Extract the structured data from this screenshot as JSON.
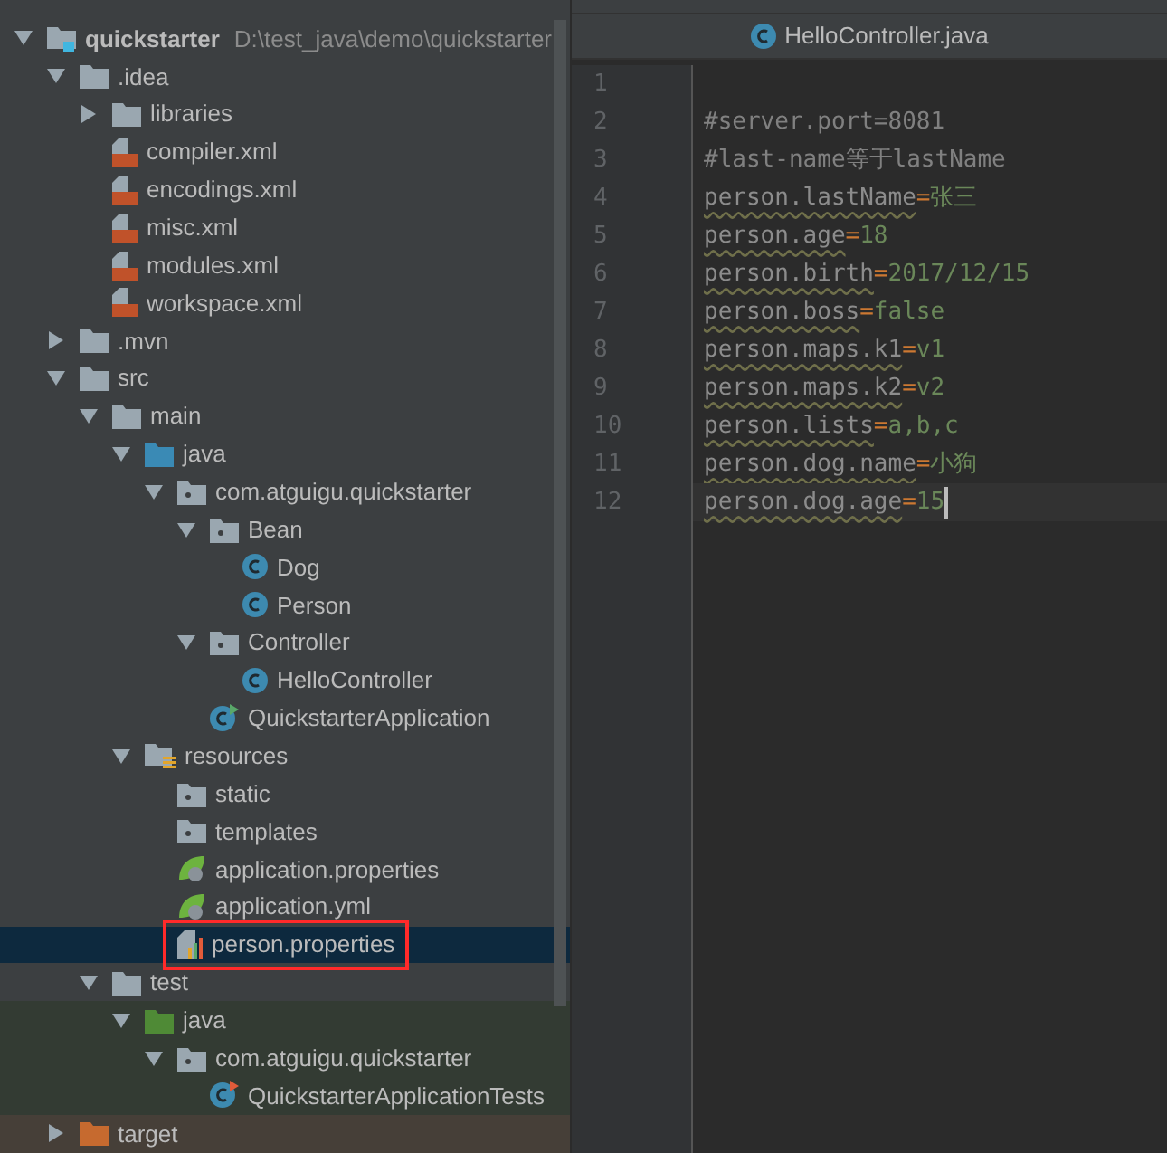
{
  "project_tree": {
    "items": [
      {
        "label": "quickstarter",
        "path": "D:\\test_java\\demo\\quickstarter",
        "kind": "module",
        "expanded": true,
        "selected": false,
        "children": [
          {
            "label": ".idea",
            "kind": "folder",
            "expanded": true,
            "selected": false,
            "children": [
              {
                "label": "libraries",
                "kind": "folder",
                "expanded": false,
                "selected": false
              },
              {
                "label": "compiler.xml",
                "kind": "xml",
                "selected": false
              },
              {
                "label": "encodings.xml",
                "kind": "xml",
                "selected": false
              },
              {
                "label": "misc.xml",
                "kind": "xml",
                "selected": false
              },
              {
                "label": "modules.xml",
                "kind": "xml",
                "selected": false
              },
              {
                "label": "workspace.xml",
                "kind": "xml",
                "selected": false
              }
            ]
          },
          {
            "label": ".mvn",
            "kind": "folder",
            "expanded": false,
            "selected": false
          },
          {
            "label": "src",
            "kind": "folder",
            "expanded": true,
            "selected": false,
            "children": [
              {
                "label": "main",
                "kind": "folder",
                "expanded": true,
                "selected": false,
                "children": [
                  {
                    "label": "java",
                    "kind": "source",
                    "expanded": true,
                    "selected": false,
                    "children": [
                      {
                        "label": "com.atguigu.quickstarter",
                        "kind": "package",
                        "expanded": true,
                        "selected": false,
                        "children": [
                          {
                            "label": "Bean",
                            "kind": "package",
                            "expanded": true,
                            "selected": false,
                            "children": [
                              {
                                "label": "Dog",
                                "kind": "class",
                                "selected": false
                              },
                              {
                                "label": "Person",
                                "kind": "class",
                                "selected": false
                              }
                            ]
                          },
                          {
                            "label": "Controller",
                            "kind": "package",
                            "expanded": true,
                            "selected": false,
                            "children": [
                              {
                                "label": "HelloController",
                                "kind": "class",
                                "selected": false
                              }
                            ]
                          },
                          {
                            "label": "QuickstarterApplication",
                            "kind": "boot",
                            "selected": false
                          }
                        ]
                      }
                    ]
                  },
                  {
                    "label": "resources",
                    "kind": "resources",
                    "expanded": true,
                    "selected": false,
                    "children": [
                      {
                        "label": "static",
                        "kind": "package",
                        "selected": false
                      },
                      {
                        "label": "templates",
                        "kind": "package",
                        "selected": false
                      },
                      {
                        "label": "application.properties",
                        "kind": "spring",
                        "selected": false
                      },
                      {
                        "label": "application.yml",
                        "kind": "spring",
                        "selected": false
                      },
                      {
                        "label": "person.properties",
                        "kind": "properties",
                        "selected": true,
                        "annotated": true
                      }
                    ]
                  }
                ]
              },
              {
                "label": "test",
                "kind": "folder",
                "expanded": true,
                "selected": false,
                "children": [
                  {
                    "label": "java",
                    "kind": "test",
                    "expanded": true,
                    "selected": false,
                    "children": [
                      {
                        "label": "com.atguigu.quickstarter",
                        "kind": "package",
                        "expanded": true,
                        "selected": false,
                        "children": [
                          {
                            "label": "QuickstarterApplicationTests",
                            "kind": "testclass",
                            "selected": false
                          }
                        ]
                      }
                    ]
                  }
                ]
              }
            ]
          },
          {
            "label": "target",
            "kind": "excluded",
            "expanded": false,
            "selected": false
          }
        ]
      }
    ]
  },
  "editor": {
    "file_tab": {
      "label": "HelloController.java"
    },
    "lines": [
      {
        "number": "1",
        "kind": "blank",
        "current": false
      },
      {
        "number": "2",
        "kind": "comment",
        "text": "#server.port=8081",
        "current": false
      },
      {
        "number": "3",
        "kind": "comment",
        "text": "#last-name等于lastName",
        "current": false
      },
      {
        "number": "4",
        "kind": "property",
        "key": "person.lastName",
        "sep": "=",
        "value": "张三",
        "current": false
      },
      {
        "number": "5",
        "kind": "property",
        "key": "person.age",
        "sep": "=",
        "value": "18",
        "current": false
      },
      {
        "number": "6",
        "kind": "property",
        "key": "person.birth",
        "sep": "=",
        "value": "2017/12/15",
        "current": false
      },
      {
        "number": "7",
        "kind": "property",
        "key": "person.boss",
        "sep": "=",
        "value": "false",
        "current": false
      },
      {
        "number": "8",
        "kind": "property",
        "key": "person.maps.k1",
        "sep": "=",
        "value": "v1",
        "current": false
      },
      {
        "number": "9",
        "kind": "property",
        "key": "person.maps.k2",
        "sep": "=",
        "value": "v2",
        "current": false
      },
      {
        "number": "10",
        "kind": "property",
        "key": "person.lists",
        "sep": "=",
        "value": "a,b,c",
        "current": false
      },
      {
        "number": "11",
        "kind": "property",
        "key": "person.dog.name",
        "sep": "=",
        "value": "小狗",
        "current": false
      },
      {
        "number": "12",
        "kind": "property",
        "key": "person.dog.age",
        "sep": "=",
        "value": "15",
        "current": true
      }
    ]
  }
}
